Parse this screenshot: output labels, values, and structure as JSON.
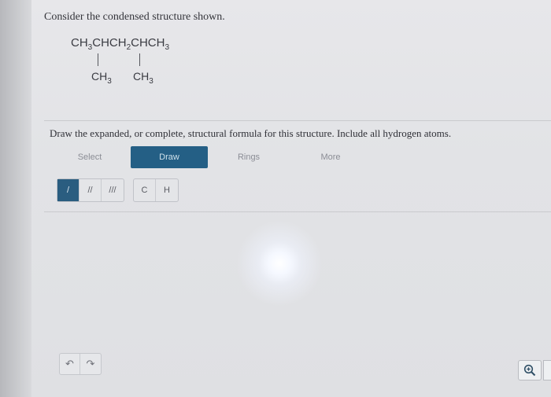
{
  "question": {
    "prompt": "Consider the condensed structure shown."
  },
  "structure": {
    "main_chain": [
      "CH",
      "3",
      "CHCH",
      "2",
      "CHCH",
      "3"
    ],
    "branches": [
      {
        "base": "CH",
        "sub": "3"
      },
      {
        "base": "CH",
        "sub": "3"
      }
    ]
  },
  "instruction": "Draw the expanded, or complete, structural formula for this structure. Include all hydrogen atoms.",
  "tabs": [
    {
      "label": "Select"
    },
    {
      "label": "Draw"
    },
    {
      "label": "Rings"
    },
    {
      "label": "More"
    }
  ],
  "active_tab": "Draw",
  "bond_tools": [
    {
      "glyph": "/",
      "icon": "single-bond-icon"
    },
    {
      "glyph": "//",
      "icon": "double-bond-icon"
    },
    {
      "glyph": "///",
      "icon": "triple-bond-icon"
    }
  ],
  "atom_tools": [
    {
      "label": "C"
    },
    {
      "label": "H"
    }
  ],
  "history": {
    "undo_glyph": "↶",
    "redo_glyph": "↷"
  },
  "colors": {
    "accent": "#245f85",
    "page_bg": "#e3e4e7"
  }
}
